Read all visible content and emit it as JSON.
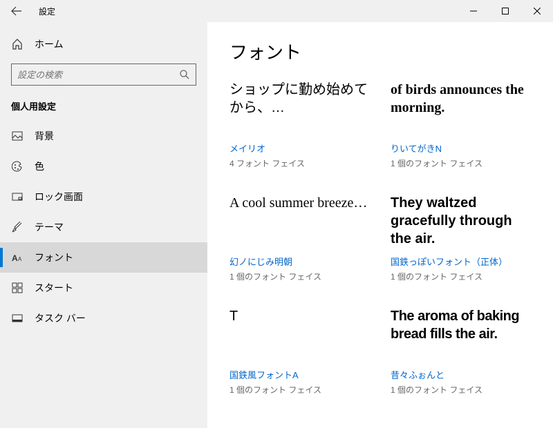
{
  "titlebar": {
    "title": "設定"
  },
  "sidebar": {
    "home": "ホーム",
    "searchPlaceholder": "設定の検索",
    "sectionHeader": "個人用設定",
    "items": [
      {
        "label": "背景"
      },
      {
        "label": "色"
      },
      {
        "label": "ロック画面"
      },
      {
        "label": "テーマ"
      },
      {
        "label": "フォント"
      },
      {
        "label": "スタート"
      },
      {
        "label": "タスク バー"
      }
    ]
  },
  "main": {
    "title": "フォント",
    "fonts": [
      {
        "preview": "ショップに勤め始めてから、…",
        "name": "メイリオ",
        "count": "4 フォント フェイス"
      },
      {
        "preview": "of birds announces the morning.",
        "name": "りいてがきN",
        "count": "1 個のフォント フェイス"
      },
      {
        "preview": "A cool summer breeze…",
        "name": "幻ノにじみ明朝",
        "count": "1 個のフォント フェイス"
      },
      {
        "preview": "They waltzed gracefully through the air.",
        "name": "国鉄っぽいフォント（正体）",
        "count": "1 個のフォント フェイス"
      },
      {
        "preview": "T",
        "name": "国鉄風フォントA",
        "count": "1 個のフォント フェイス"
      },
      {
        "preview": "The aroma of baking bread fills the air.",
        "name": "昔々ふぉんと",
        "count": "1 個のフォント フェイス"
      }
    ]
  }
}
